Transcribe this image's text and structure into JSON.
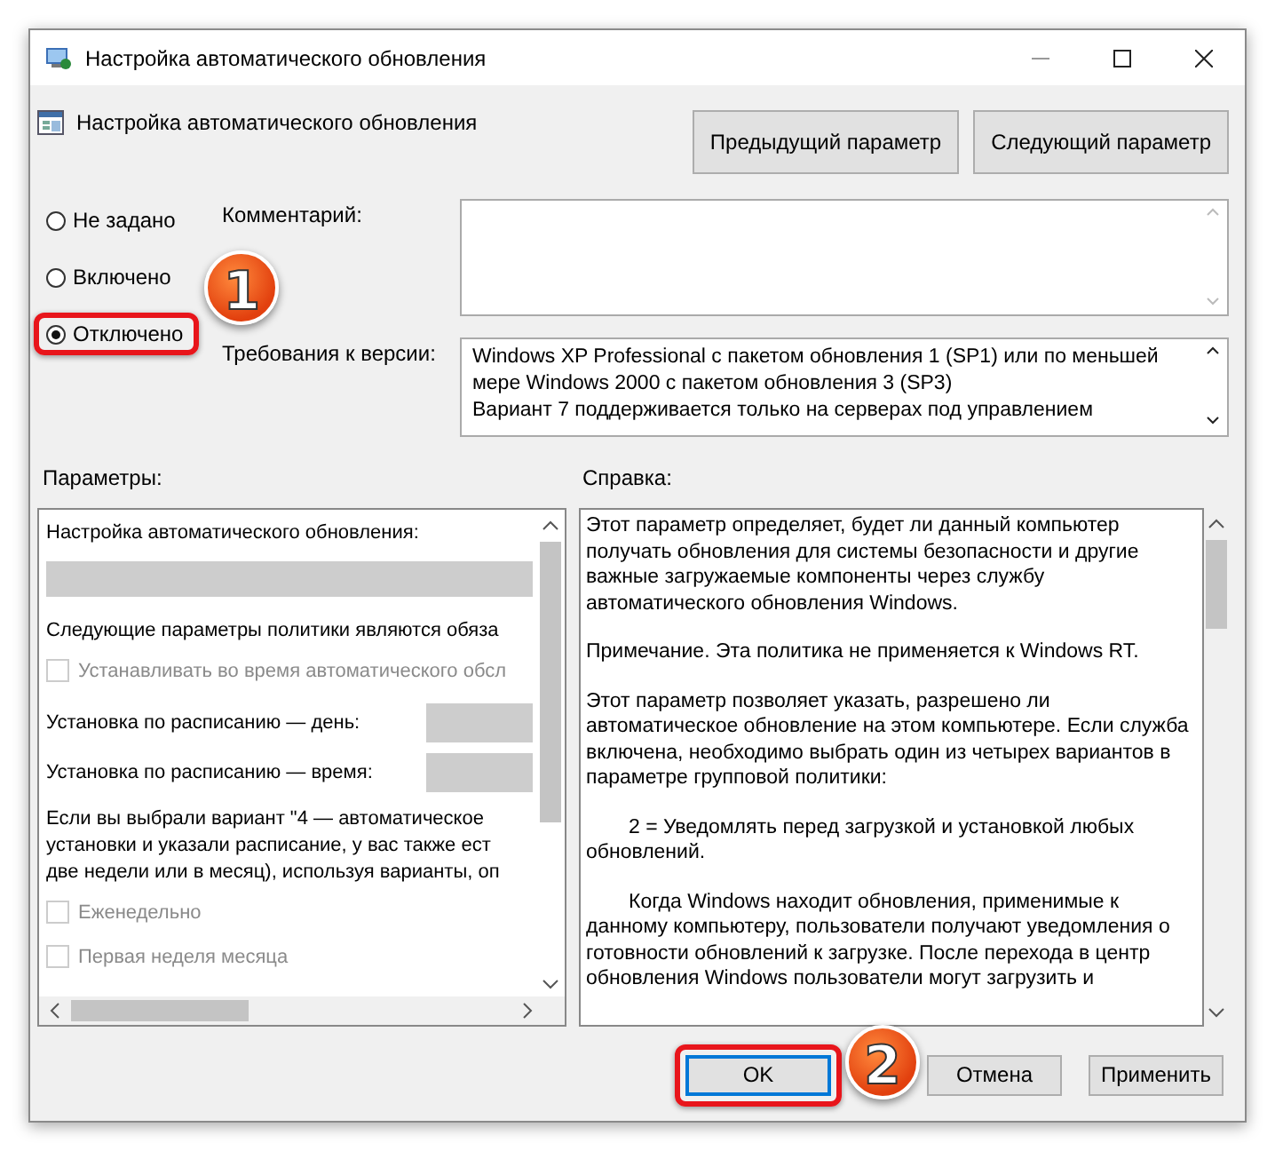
{
  "window": {
    "title": "Настройка автоматического обновления"
  },
  "header": {
    "title": "Настройка автоматического обновления",
    "buttons": [
      "Предыдущий параметр",
      "Следующий параметр"
    ]
  },
  "state_options": [
    {
      "label": "Не задано",
      "selected": false,
      "highlighted": false
    },
    {
      "label": "Включено",
      "selected": false,
      "highlighted": false
    },
    {
      "label": "Отключено",
      "selected": true,
      "highlighted": true
    }
  ],
  "comment": {
    "label": "Комментарий:"
  },
  "requirements": {
    "label": "Требования к версии:",
    "lines": [
      "Windows XP Professional с пакетом обновления 1 (SP1) или по меньшей мере Windows 2000 с пакетом обновления 3 (SP3)",
      "Вариант 7 поддерживается только на серверах под управлением"
    ]
  },
  "parameters": {
    "label": "Параметры:",
    "items": [
      {
        "kind": "text",
        "text": "Настройка автоматического обновления:"
      },
      {
        "kind": "dropdown"
      },
      {
        "kind": "text",
        "text": "Следующие параметры политики являются обяза"
      },
      {
        "kind": "checkbox",
        "text": "Устанавливать во время автоматического обсл",
        "checked": false
      },
      {
        "kind": "field",
        "text": "Установка по расписанию — день:"
      },
      {
        "kind": "field",
        "text": "Установка по расписанию — время:"
      },
      {
        "kind": "text",
        "text": "Если вы выбрали вариант \"4 — автоматическое\nустановки и указали расписание, у вас также ест\nдве недели или в месяц), используя варианты, оп"
      },
      {
        "kind": "checkbox",
        "text": "Еженедельно",
        "checked": false
      },
      {
        "kind": "checkbox",
        "text": "Первая неделя месяца",
        "checked": false
      }
    ]
  },
  "help": {
    "label": "Справка:",
    "paragraphs": [
      {
        "text": "Этот параметр определяет, будет ли данный компьютер получать обновления для системы безопасности и другие важные загружаемые компоненты через службу автоматического обновления Windows.",
        "indent": false
      },
      {
        "text": "Примечание. Эта политика не применяется к Windows RT.",
        "indent": false
      },
      {
        "text": "Этот параметр позволяет указать, разрешено ли автоматическое обновление на этом компьютере. Если служба включена, необходимо выбрать один из четырех вариантов в параметре групповой политики:",
        "indent": false
      },
      {
        "text": "2 = Уведомлять перед загрузкой и установкой любых обновлений.",
        "indent": true
      },
      {
        "text": "Когда Windows находит обновления, применимые к данному компьютеру, пользователи получают уведомления о готовности обновлений к загрузке. После перехода в центр обновления Windows пользователи могут загрузить и",
        "indent": true
      }
    ]
  },
  "buttons": [
    {
      "label": "OK",
      "default": true,
      "highlighted": true
    },
    {
      "label": "Отмена",
      "default": false,
      "highlighted": false
    },
    {
      "label": "Применить",
      "default": false,
      "highlighted": false
    }
  ],
  "annotations": [
    {
      "label": "1"
    },
    {
      "label": "2"
    }
  ]
}
